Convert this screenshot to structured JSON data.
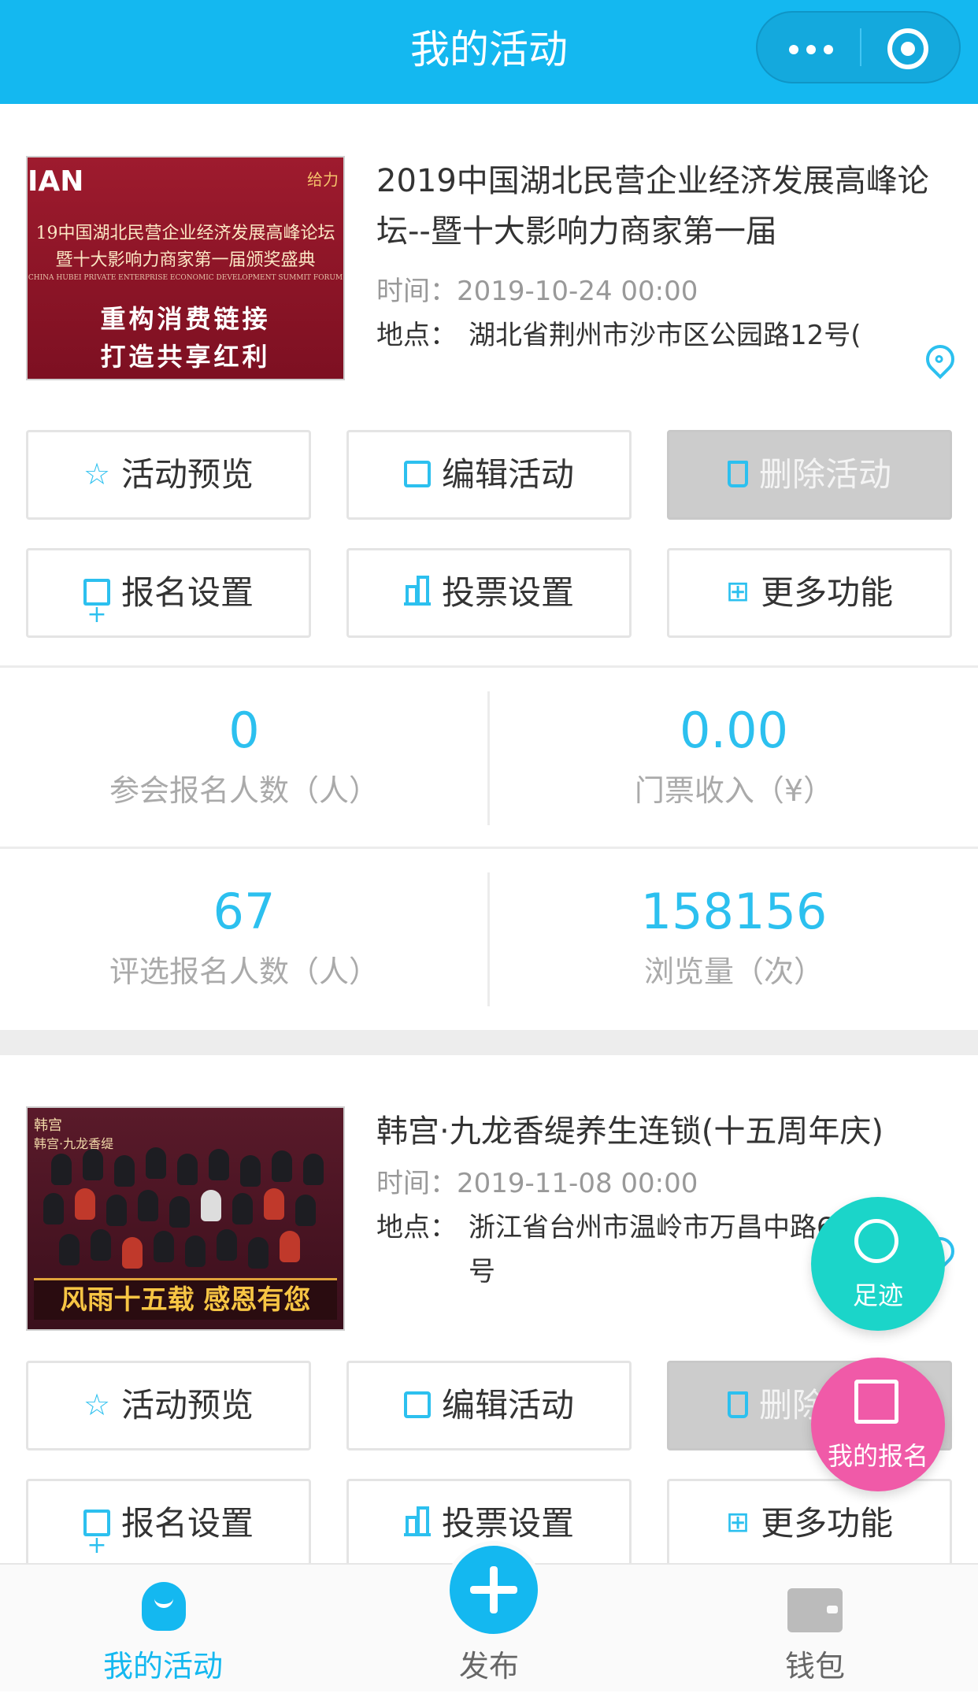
{
  "header": {
    "title": "我的活动"
  },
  "activities": [
    {
      "title": "2019中国湖北民营企业经济发展高峰论坛--暨十大影响力商家第一届",
      "time_label": "时间：",
      "time": "2019-10-24 00:00",
      "addr_label": "地点：",
      "addr": "湖北省荆州市沙市区公园路12号(",
      "poster": {
        "logo": "IAN",
        "brand": "给力",
        "line1": "19中国湖北民营企业经济发展高峰论坛",
        "line2": "暨十大影响力商家第一届颁奖盛典",
        "line3": "CHINA HUBEI PRIVATE ENTERPRISE ECONOMIC DEVELOPMENT SUMMIT FORUM",
        "slogan1": "重构消费链接",
        "slogan2": "打造共享红利"
      },
      "buttons": [
        "活动预览",
        "编辑活动",
        "删除活动",
        "报名设置",
        "投票设置",
        "更多功能"
      ],
      "stats": [
        {
          "value": "0",
          "label": "参会报名人数（人）"
        },
        {
          "value": "0.00",
          "label": "门票收入（¥）"
        },
        {
          "value": "67",
          "label": "评选报名人数（人）"
        },
        {
          "value": "158156",
          "label": "浏览量（次）"
        }
      ]
    },
    {
      "title": "韩宫·九龙香缇养生连锁(十五周年庆)",
      "time_label": "时间：",
      "time": "2019-11-08 00:00",
      "addr_label": "地点：",
      "addr": "浙江省台州市温岭市万昌中路688号",
      "poster": {
        "brand": "韩宫",
        "line1": "韩宫·九龙香缇",
        "banner": "风雨十五载 感恩有您"
      },
      "buttons": [
        "活动预览",
        "编辑活动",
        "删除活动",
        "报名设置",
        "投票设置",
        "更多功能"
      ]
    }
  ],
  "floating": {
    "footprint": "足迹",
    "my_registration": "我的报名"
  },
  "tabbar": {
    "tabs": [
      "我的活动",
      "发布",
      "钱包"
    ],
    "active": "我的活动"
  },
  "colors": {
    "primary": "#14b8f0",
    "accent": "#2cc0ef",
    "teal": "#1bd5c9",
    "pink": "#f05aa8"
  }
}
